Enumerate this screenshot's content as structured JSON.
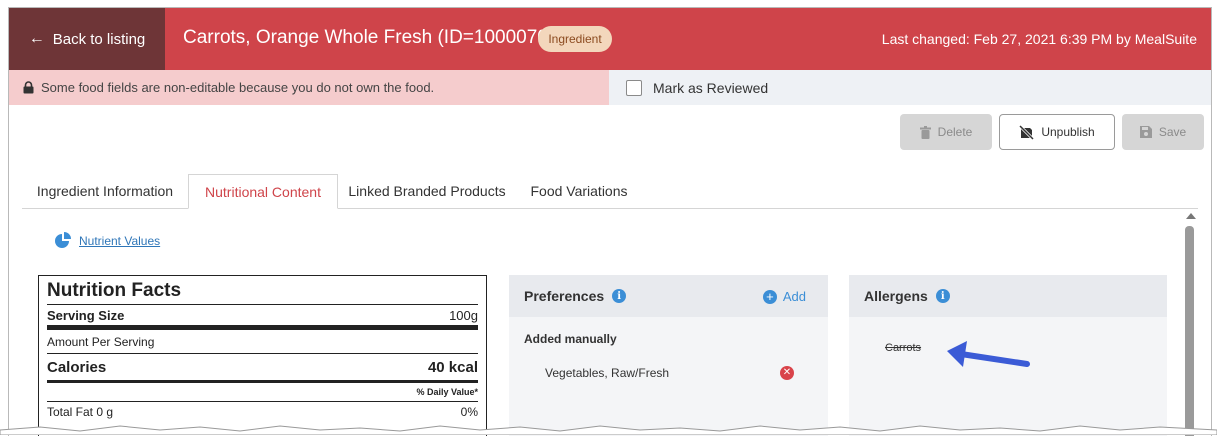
{
  "header": {
    "back_label": "Back to listing",
    "title": "Carrots, Orange Whole Fresh (ID=1000070)",
    "badge": "Ingredient",
    "last_changed": "Last changed: Feb 27, 2021 6:39 PM by MealSuite",
    "bg_color": "#cf444a"
  },
  "notice": {
    "text": "Some food fields are non-editable because you do not own the food."
  },
  "review": {
    "label": "Mark as Reviewed",
    "checked": false
  },
  "actions": {
    "delete_label": "Delete",
    "unpublish_label": "Unpublish",
    "save_label": "Save"
  },
  "tabs": [
    {
      "label": "Ingredient Information",
      "active": false
    },
    {
      "label": "Nutritional Content",
      "active": true
    },
    {
      "label": "Linked Branded Products",
      "active": false
    },
    {
      "label": "Food Variations",
      "active": false
    }
  ],
  "nutrient_link": "Nutrient Values",
  "nutrition_facts": {
    "title": "Nutrition Facts",
    "serving_size_label": "Serving Size",
    "serving_size_value": "100g",
    "amount_per_serving": "Amount Per Serving",
    "calories_label": "Calories",
    "calories_value": "40 kcal",
    "daily_value_label": "% Daily Value*",
    "total_fat_label": "Total Fat 0 g",
    "total_fat_dv": "0%"
  },
  "preferences": {
    "title": "Preferences",
    "add_label": "Add",
    "group_label": "Added manually",
    "items": [
      "Vegetables, Raw/Fresh"
    ]
  },
  "allergens": {
    "title": "Allergens",
    "items": [
      "Carrots"
    ]
  },
  "icons": {
    "back": "arrow-left-icon",
    "lock": "lock-icon",
    "info": "info-icon",
    "add": "plus-circle-icon",
    "remove": "x-circle-icon",
    "chart": "pie-chart-icon",
    "trash": "trash-icon",
    "unpublish": "unpublish-icon",
    "save": "floppy-disk-icon"
  }
}
